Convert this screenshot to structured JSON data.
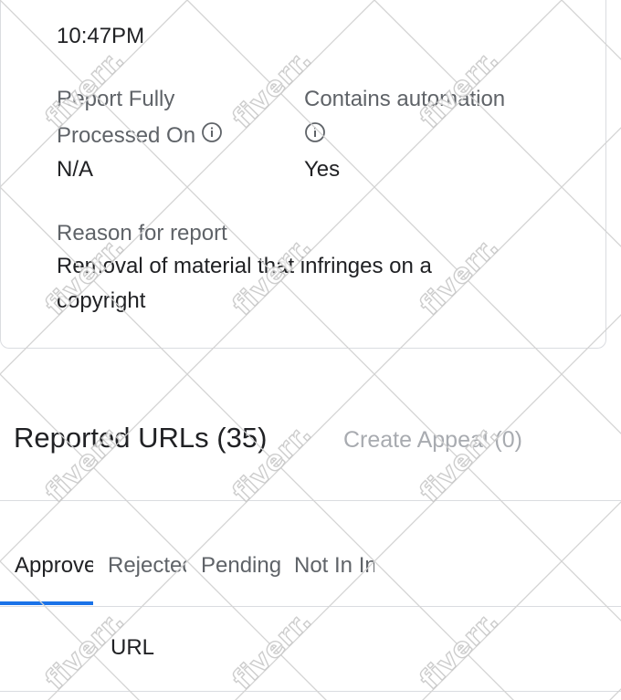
{
  "report": {
    "timestamp_time": "10:47PM",
    "processed_label_line1": "Report Fully",
    "processed_label_line2": "Processed On",
    "processed_value": "N/A",
    "automation_label": "Contains automation",
    "automation_value": "Yes",
    "reason_label": "Reason for report",
    "reason_line1": "Removal of material that infringes on a",
    "reason_line2": "copyright"
  },
  "urls_section": {
    "title": "Reported URLs (35)",
    "create_appeal": "Create Appeal (0)"
  },
  "tabs": [
    {
      "label": "Approved",
      "active": true
    },
    {
      "label": "Rejected",
      "active": false
    },
    {
      "label": "Pending",
      "active": false
    },
    {
      "label": "Not In Index",
      "active": false
    }
  ],
  "table": {
    "column_url": "URL"
  },
  "watermark": {
    "text": "fiverr."
  },
  "colors": {
    "accent": "#1a73e8",
    "text_primary": "#202124",
    "text_secondary": "#5f6368",
    "disabled": "#a8abb0",
    "border": "#dadce0"
  },
  "icons": {
    "info": "info-circle-icon"
  }
}
